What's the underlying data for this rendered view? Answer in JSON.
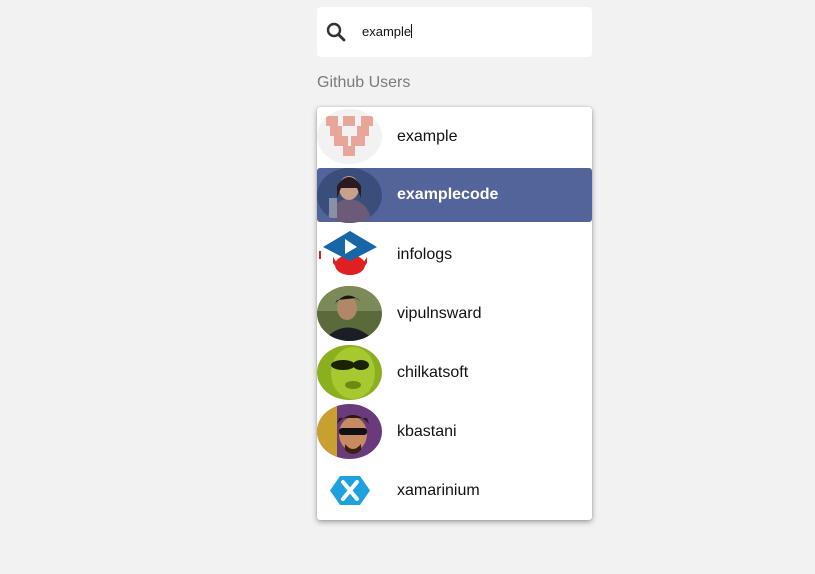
{
  "search": {
    "query": "example"
  },
  "section": {
    "label": "Github Users"
  },
  "users": [
    {
      "name": "example",
      "avatar": "identicon-avatar",
      "selected": false
    },
    {
      "name": "examplecode",
      "avatar": "photo-avatar",
      "selected": true
    },
    {
      "name": "infologs",
      "avatar": "logo-avatar",
      "selected": false
    },
    {
      "name": "vipulnsward",
      "avatar": "photo-avatar",
      "selected": false
    },
    {
      "name": "chilkatsoft",
      "avatar": "photo-avatar",
      "selected": false
    },
    {
      "name": "kbastani",
      "avatar": "photo-avatar",
      "selected": false
    },
    {
      "name": "xamarinium",
      "avatar": "xamarin-logo-avatar",
      "selected": false
    }
  ],
  "colors": {
    "selected_bg": "#53649b",
    "page_bg": "#f2f2f2"
  }
}
